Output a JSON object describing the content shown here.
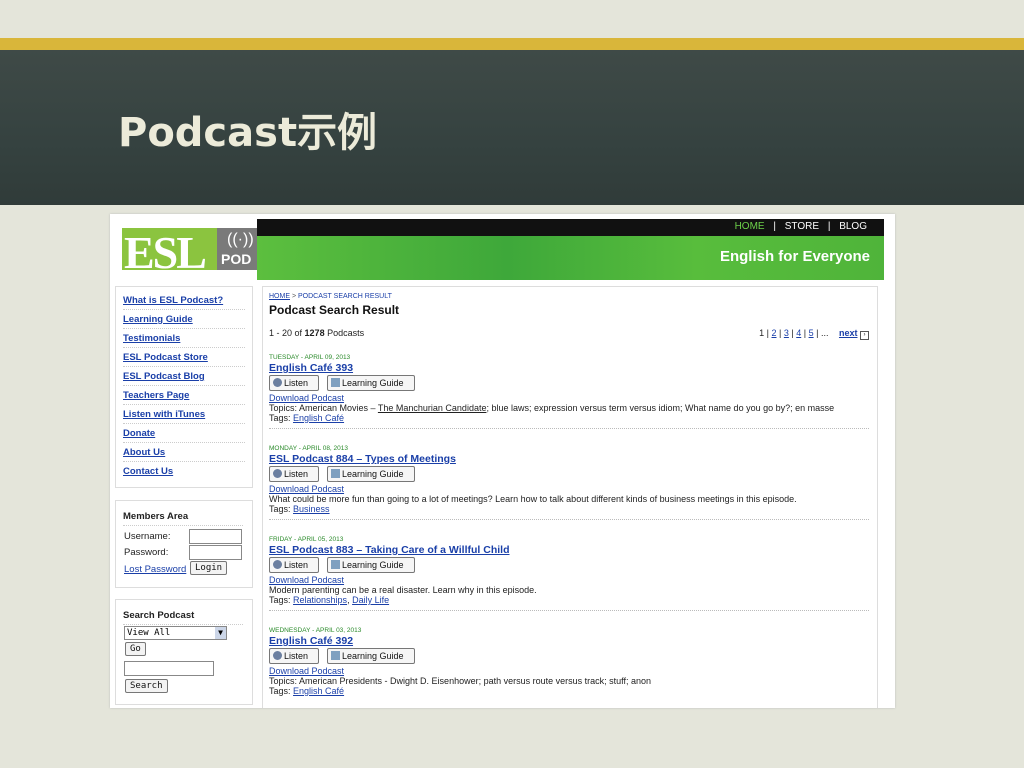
{
  "slide": {
    "title": "Podcast示例"
  },
  "logo": {
    "esl": "ESL",
    "pod": "POD"
  },
  "topnav": {
    "home": "HOME",
    "store": "STORE",
    "blog": "BLOG",
    "sep": "|"
  },
  "header": {
    "tagline": "English for Everyone"
  },
  "sidebar": {
    "items": [
      {
        "label": "What is ESL Podcast?"
      },
      {
        "label": "Learning Guide"
      },
      {
        "label": "Testimonials"
      },
      {
        "label": "ESL Podcast Store"
      },
      {
        "label": "ESL Podcast Blog"
      },
      {
        "label": "Teachers Page"
      },
      {
        "label": "Listen with iTunes"
      },
      {
        "label": "Donate"
      },
      {
        "label": "About Us"
      },
      {
        "label": "Contact Us"
      }
    ]
  },
  "members": {
    "title": "Members Area",
    "username_label": "Username:",
    "password_label": "Password:",
    "lost_password": "Lost Password",
    "login_button": "Login"
  },
  "search": {
    "title": "Search Podcast",
    "select_value": "View All",
    "go_button": "Go",
    "search_button": "Search"
  },
  "main": {
    "breadcrumb_home": "HOME",
    "breadcrumb_sep": ">",
    "breadcrumb_current": "PODCAST SEARCH RESULT",
    "title": "Podcast Search Result",
    "count_prefix": "1 - 20 of",
    "count_total": "1278",
    "count_suffix": "Podcasts",
    "pager": {
      "first": "1",
      "pages": [
        "2",
        "3",
        "4",
        "5"
      ],
      "ellipsis": "...",
      "next": "next"
    },
    "listen_label": "Listen",
    "guide_label": "Learning Guide",
    "download_label": "Download Podcast",
    "tags_label": "Tags:",
    "episodes": [
      {
        "date": "TUESDAY - APRIL 09, 2013",
        "title": "English Café 393",
        "desc_pre": "Topics: American Movies – ",
        "desc_link": "The Manchurian Candidate",
        "desc_post": "; blue laws; expression versus term versus idiom; What name do you go by?; en masse",
        "tags": [
          "English Café"
        ]
      },
      {
        "date": "MONDAY - APRIL 08, 2013",
        "title": "ESL Podcast 884 – Types of Meetings",
        "desc_pre": "What could be more fun than going to a lot of meetings? Learn how to talk about different kinds of business meetings in this episode.",
        "desc_link": "",
        "desc_post": "",
        "tags": [
          "Business"
        ]
      },
      {
        "date": "FRIDAY - APRIL 05, 2013",
        "title": "ESL Podcast 883 – Taking Care of a Willful Child",
        "desc_pre": "Modern parenting can be a real disaster. Learn why in this episode.",
        "desc_link": "",
        "desc_post": "",
        "tags": [
          "Relationships",
          "Daily Life"
        ]
      },
      {
        "date": "WEDNESDAY - APRIL 03, 2013",
        "title": "English Café 392",
        "desc_pre": "Topics: American Presidents - Dwight D. Eisenhower; path versus route versus track; stuff; anon",
        "desc_link": "",
        "desc_post": "",
        "tags": [
          "English Café"
        ]
      }
    ]
  }
}
